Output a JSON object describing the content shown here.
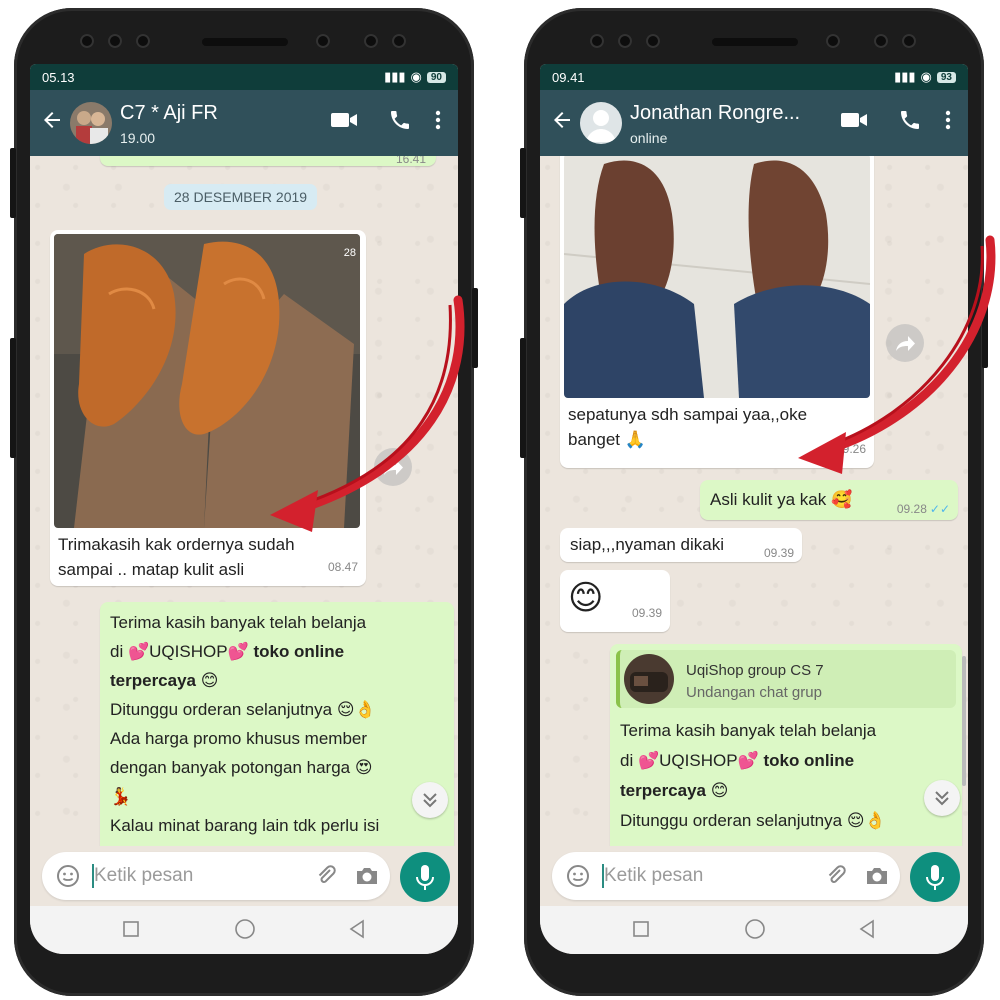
{
  "left": {
    "status": {
      "time": "05.13",
      "battery": "90"
    },
    "header": {
      "name": "C7 * Aji FR",
      "subtitle": "19.00"
    },
    "date_chip": "28 DESEMBER 2019",
    "photo_msg": {
      "caption_line1": "Trimakasih kak ordernya sudah",
      "caption_line2": "sampai .. matap kulit asli",
      "time": "08.47",
      "photo_date_mark": "28"
    },
    "partial_top_time": "16.41",
    "out_msg": {
      "line1": "Terima kasih banyak telah belanja",
      "line2a": "di ",
      "shop": "UQISHOP",
      "line2b": " toko online",
      "line3": "terpercaya",
      "line4": "Ditunggu orderan selanjutnya",
      "line5": "Ada harga promo khusus member",
      "line6": "dengan banyak potongan harga",
      "line8": "Kalau minat barang lain tdk perlu isi"
    },
    "input_placeholder": "Ketik pesan"
  },
  "right": {
    "status": {
      "time": "09.41",
      "battery": "93"
    },
    "header": {
      "name": "Jonathan Rongre...",
      "subtitle": "online"
    },
    "photo_msg": {
      "caption_line1": "sepatunya sdh sampai yaa,,oke",
      "caption_line2": "banget",
      "time": "09.26"
    },
    "msg_asli": {
      "text": "Asli kulit ya kak",
      "time": "09.28"
    },
    "msg_siap": {
      "text": "siap,,,nyaman dikaki",
      "time": "09.39"
    },
    "msg_emoji": {
      "time": "09.39"
    },
    "out_msg": {
      "quote_title": "UqiShop group CS 7",
      "quote_sub": "Undangan chat grup",
      "line1": "Terima kasih banyak telah belanja",
      "line2a": "di ",
      "shop": "UQISHOP",
      "line2b": " toko online",
      "line3": "terpercaya",
      "line4": "Ditunggu orderan selanjutnya"
    },
    "input_placeholder": "Ketik pesan"
  },
  "colors": {
    "header": "#30505a",
    "statusbar": "#0f3d3a",
    "outgoing": "#dcf8c6",
    "incoming": "#ffffff",
    "mic": "#0e8f7e",
    "arrow": "#d3212d"
  }
}
